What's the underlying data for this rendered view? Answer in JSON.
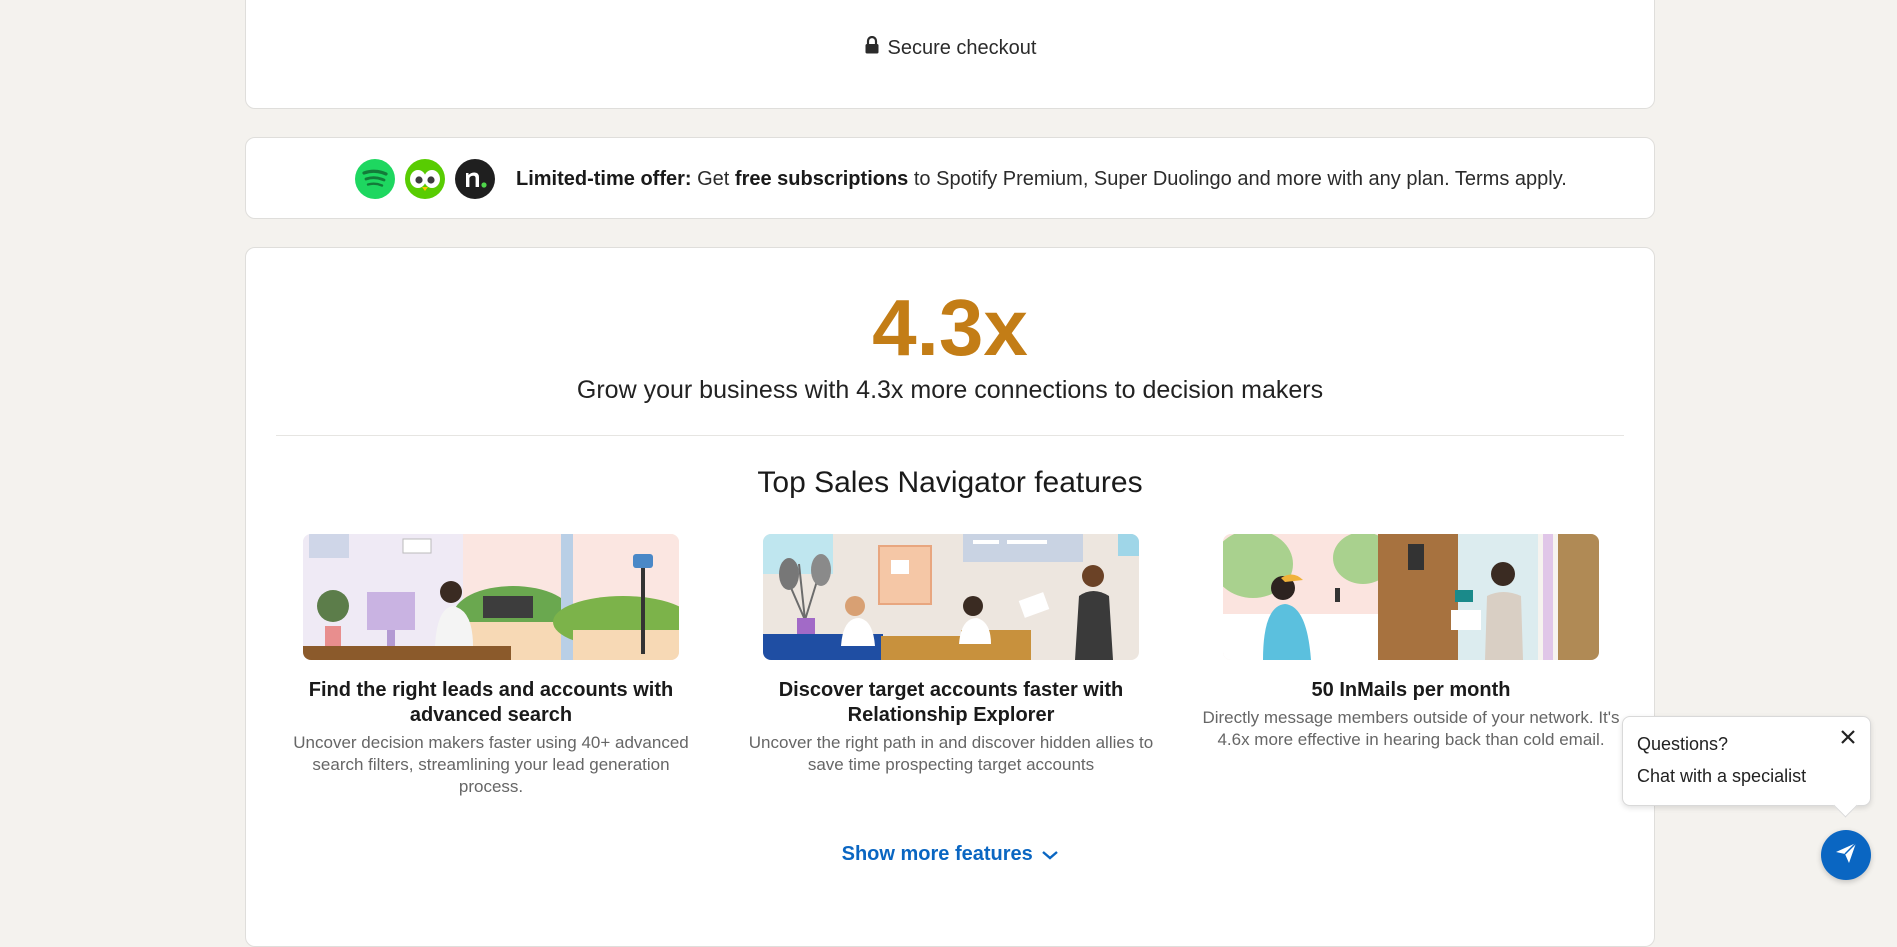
{
  "checkout": {
    "label": "Secure checkout",
    "icon": "lock-icon"
  },
  "offer": {
    "logos": [
      "spotify-logo",
      "duolingo-logo",
      "noom-logo"
    ],
    "lead": "Limited-time offer:",
    "text_1": " Get ",
    "highlight": "free subscriptions",
    "text_2": " to Spotify Premium, Super Duolingo and more with any plan. Terms apply."
  },
  "stats": {
    "value": "4.3x",
    "description": "Grow your business with 4.3x more connections to decision makers"
  },
  "features_section": {
    "title": "Top Sales Navigator features",
    "items": [
      {
        "title_line1": "Find the right leads and accounts with",
        "title_line2": "advanced search",
        "desc_line1": "Uncover decision makers faster using 40+ advanced",
        "desc_line2": "search filters, streamlining your lead generation",
        "desc_line3": "process."
      },
      {
        "title_line1": "Discover target accounts faster with",
        "title_line2": "Relationship Explorer",
        "desc_line1": "Uncover the right path in and discover hidden allies to",
        "desc_line2": "save time prospecting target accounts"
      },
      {
        "title_line1": "50 InMails per month",
        "desc_line1": "Directly message members outside of your network. It's",
        "desc_line2": "4.6x more effective in hearing back than cold email."
      }
    ],
    "show_more": "Show more features"
  },
  "chat": {
    "question": "Questions?",
    "cta": "Chat with a specialist",
    "button_icon": "send-icon",
    "close_icon": "close-icon"
  },
  "colors": {
    "page_bg": "#f4f2ee",
    "accent_gold": "#c37d16",
    "link_blue": "#0a66c2",
    "spotify_green": "#1ed760",
    "duolingo_green": "#58cc02"
  }
}
